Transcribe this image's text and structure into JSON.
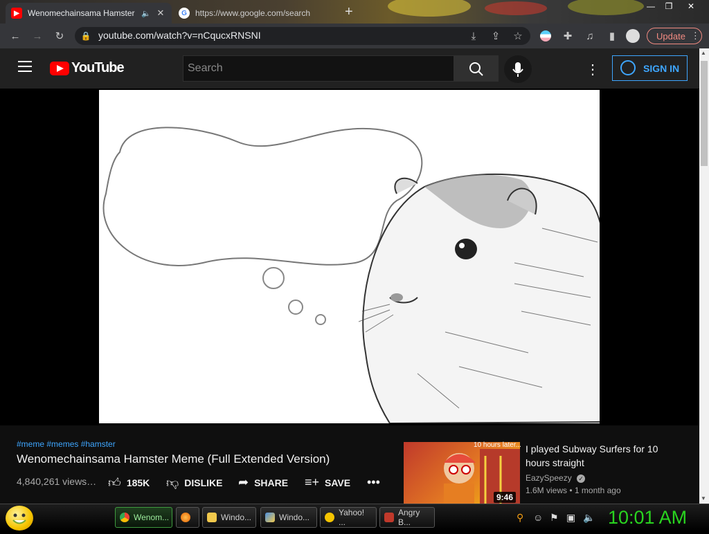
{
  "browser": {
    "tabs": [
      {
        "title": "Wenomechainsama Hamster",
        "active": true
      },
      {
        "title": "https://www.google.com/search",
        "active": false
      }
    ],
    "url": "youtube.com/watch?v=nCqucxRNSNI",
    "update_label": "Update"
  },
  "youtube": {
    "logo_text": "YouTube",
    "search_placeholder": "Search",
    "signin_label": "SIGN IN"
  },
  "video": {
    "tags": "#meme #memes #hamster",
    "title": "Wenomechainsama Hamster Meme (Full Extended Version)",
    "views": "4,840,261 views…",
    "likes": "185K",
    "dislike_label": "DISLIKE",
    "share_label": "SHARE",
    "save_label": "SAVE"
  },
  "recommendation": {
    "title": "I played Subway Surfers for 10 hours straight",
    "channel": "EazySpeezy",
    "views": "1.6M views",
    "age": "1 month ago",
    "duration": "9:46",
    "thumb_caption": "10 hours later..."
  },
  "taskbar": {
    "items": [
      {
        "label": "Wenom...",
        "icon": "chrome-icon",
        "active": true
      },
      {
        "label": "",
        "icon": "firefox-icon",
        "active": false
      },
      {
        "label": "Windo...",
        "icon": "folder-icon",
        "active": false
      },
      {
        "label": "Windo...",
        "icon": "paint-icon",
        "active": false
      },
      {
        "label": "Yahoo! ...",
        "icon": "yahoo-icon",
        "active": false
      },
      {
        "label": "Angry B...",
        "icon": "angry-birds-icon",
        "active": false
      }
    ],
    "clock": "10:01 AM"
  },
  "colors": {
    "accent_blue": "#3ea6ff",
    "youtube_red": "#ff0000",
    "clock_green": "#29d41f"
  }
}
